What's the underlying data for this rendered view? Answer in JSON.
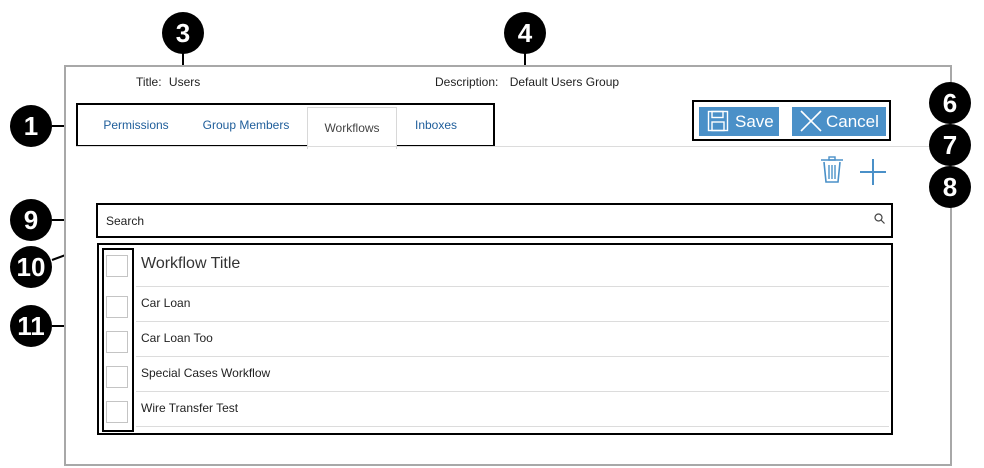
{
  "header": {
    "title_label": "Title:",
    "title_value": "Users",
    "description_label": "Description:",
    "description_value": "Default Users Group"
  },
  "tabs": [
    {
      "label": "Permissions",
      "active": false
    },
    {
      "label": "Group Members",
      "active": false
    },
    {
      "label": "Workflows",
      "active": true
    },
    {
      "label": "Inboxes",
      "active": false
    }
  ],
  "actions": {
    "save_label": "Save",
    "cancel_label": "Cancel",
    "delete_icon": "trash-icon",
    "add_icon": "plus-icon"
  },
  "search": {
    "placeholder": "Search",
    "icon": "search-icon"
  },
  "list": {
    "header": "Workflow Title",
    "rows": [
      "Car Loan",
      "Car Loan Too",
      "Special Cases Workflow",
      "Wire Transfer Test"
    ]
  },
  "callouts": [
    "1",
    "3",
    "4",
    "6",
    "7",
    "8",
    "9",
    "10",
    "11"
  ],
  "colors": {
    "accent": "#4a90c8",
    "link": "#1e5d9a",
    "callout": "#000000"
  }
}
